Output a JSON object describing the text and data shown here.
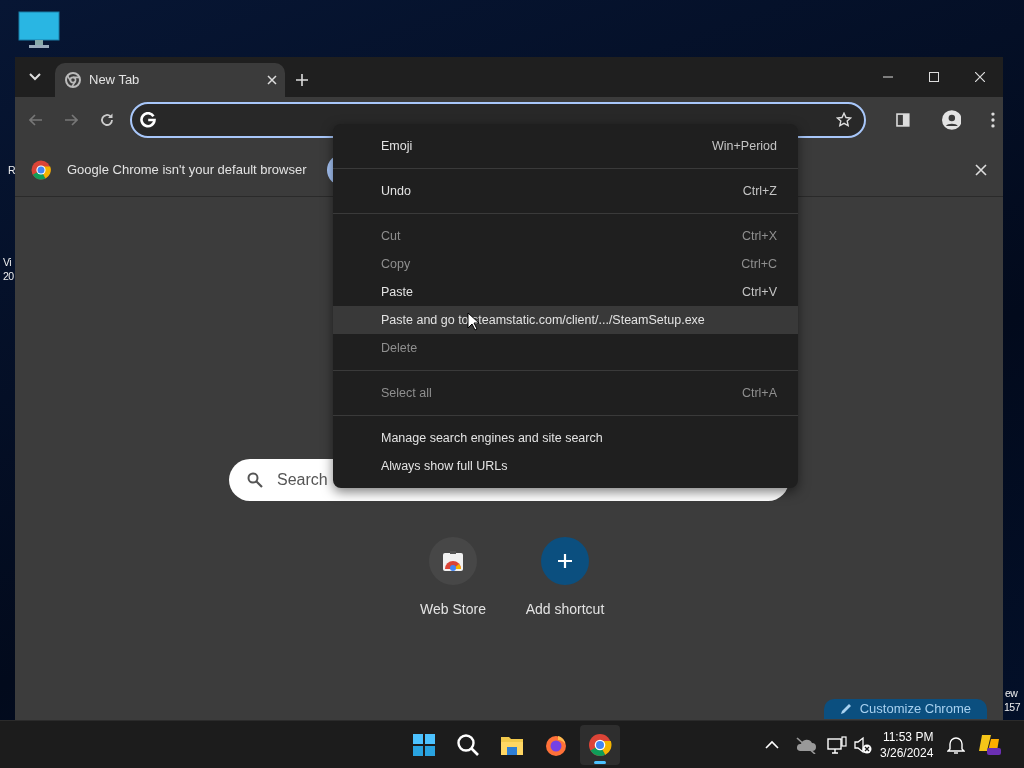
{
  "desktop": {
    "fragments": [
      {
        "text": "R"
      },
      {
        "text": "Vi"
      },
      {
        "text": "20"
      },
      {
        "text": "ew"
      },
      {
        "text": "157"
      }
    ]
  },
  "browser": {
    "tabs": [
      {
        "title": "New Tab",
        "selected": true
      }
    ],
    "banner": {
      "message": "Google Chrome isn't your default browser"
    },
    "new_tab_page": {
      "search": {
        "placeholder": "Search"
      },
      "shortcuts": [
        {
          "kind": "site",
          "label": "Web Store"
        },
        {
          "kind": "add",
          "label": "Add shortcut"
        }
      ],
      "customize_button": "Customize Chrome"
    }
  },
  "context_menu": [
    {
      "kind": "item",
      "label": "Emoji",
      "shortcut": "Win+Period",
      "disabled": false,
      "highlighted": false
    },
    {
      "kind": "separator"
    },
    {
      "kind": "item",
      "label": "Undo",
      "shortcut": "Ctrl+Z",
      "disabled": false,
      "highlighted": false
    },
    {
      "kind": "separator"
    },
    {
      "kind": "item",
      "label": "Cut",
      "shortcut": "Ctrl+X",
      "disabled": true,
      "highlighted": false
    },
    {
      "kind": "item",
      "label": "Copy",
      "shortcut": "Ctrl+C",
      "disabled": true,
      "highlighted": false
    },
    {
      "kind": "item",
      "label": "Paste",
      "shortcut": "Ctrl+V",
      "disabled": false,
      "highlighted": false
    },
    {
      "kind": "item",
      "label": "Paste and go to steamstatic.com/client/.../SteamSetup.exe",
      "disabled": false,
      "highlighted": true
    },
    {
      "kind": "item",
      "label": "Delete",
      "disabled": true,
      "highlighted": false
    },
    {
      "kind": "separator"
    },
    {
      "kind": "item",
      "label": "Select all",
      "shortcut": "Ctrl+A",
      "disabled": true,
      "highlighted": false
    },
    {
      "kind": "separator"
    },
    {
      "kind": "item",
      "label": "Manage search engines and site search",
      "disabled": false,
      "highlighted": false
    },
    {
      "kind": "item",
      "label": "Always show full URLs",
      "disabled": false,
      "highlighted": false
    }
  ],
  "taskbar": {
    "apps": [
      {
        "kind": "start",
        "selected": false
      },
      {
        "kind": "search",
        "selected": false
      },
      {
        "kind": "folder",
        "selected": false
      },
      {
        "kind": "firefox",
        "selected": false
      },
      {
        "kind": "chrome",
        "selected": true
      }
    ],
    "clock": {
      "time": "11:53 PM",
      "date": "3/26/2024"
    }
  }
}
